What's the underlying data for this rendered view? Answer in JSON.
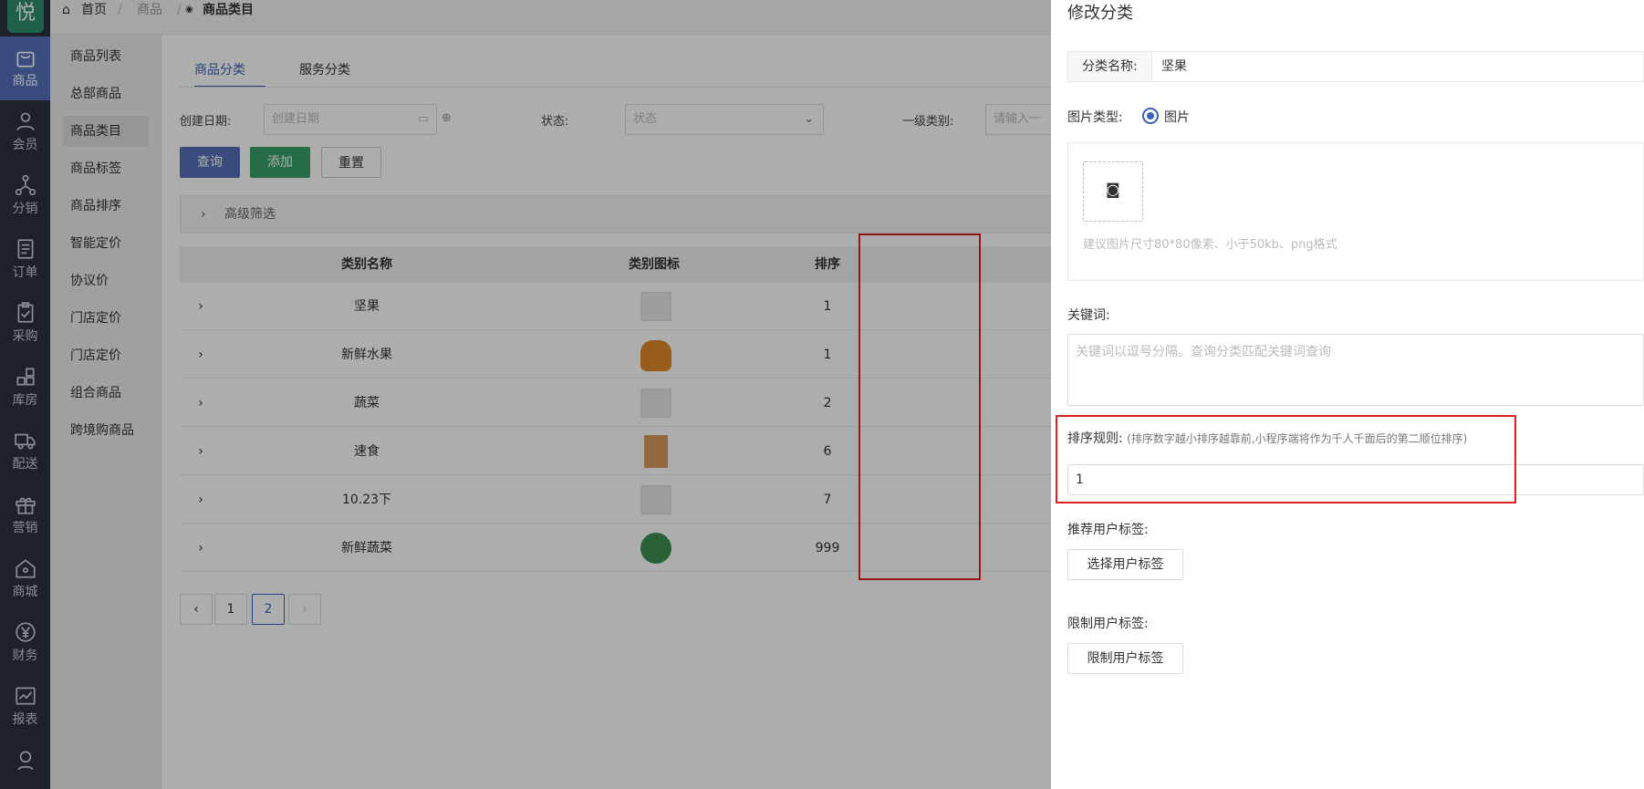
{
  "rail": {
    "logo": "悦",
    "items": [
      {
        "label": "商品",
        "icon": "bag-icon"
      },
      {
        "label": "会员",
        "icon": "user-icon"
      },
      {
        "label": "分销",
        "icon": "network-icon"
      },
      {
        "label": "订单",
        "icon": "order-icon"
      },
      {
        "label": "采购",
        "icon": "clipboard-icon"
      },
      {
        "label": "库房",
        "icon": "warehouse-icon"
      },
      {
        "label": "配送",
        "icon": "truck-icon"
      },
      {
        "label": "营销",
        "icon": "gift-icon"
      },
      {
        "label": "商城",
        "icon": "home-icon"
      },
      {
        "label": "财务",
        "icon": "yen-icon"
      },
      {
        "label": "报表",
        "icon": "chart-icon"
      }
    ]
  },
  "submenu": {
    "items": [
      "商品列表",
      "总部商品",
      "商品类目",
      "商品标签",
      "商品排序",
      "智能定价",
      "协议价",
      "门店定价",
      "门店定价",
      "组合商品",
      "跨境购商品"
    ],
    "active_index": 2
  },
  "breadcrumb": {
    "home": "首页",
    "level1": "商品",
    "current": "商品类目"
  },
  "tabs": [
    "商品分类",
    "服务分类"
  ],
  "filters": {
    "created_label": "创建日期:",
    "created_placeholder": "创建日期",
    "status_label": "状态:",
    "status_placeholder": "状态",
    "level1_label": "一级类别:",
    "level1_placeholder": "请输入一"
  },
  "buttons": {
    "query": "查询",
    "add": "添加",
    "reset": "重置"
  },
  "advanced_filter": "高级筛选",
  "table": {
    "headers": [
      "类别名称",
      "类别图标",
      "排序"
    ],
    "rows": [
      {
        "name": "坚果",
        "icon": "placeholder-image-icon",
        "sort": "1"
      },
      {
        "name": "新鲜水果",
        "icon": "fruit-basket-icon",
        "sort": "1"
      },
      {
        "name": "蔬菜",
        "icon": "placeholder-image-icon",
        "sort": "2"
      },
      {
        "name": "速食",
        "icon": "food-bag-icon",
        "sort": "6"
      },
      {
        "name": "10.23下",
        "icon": "placeholder-image-icon",
        "sort": "7"
      },
      {
        "name": "新鲜蔬菜",
        "icon": "vegetable-icon",
        "sort": "999"
      }
    ]
  },
  "pagination": {
    "prev": "‹",
    "pages": [
      "1",
      "2"
    ],
    "active": "2",
    "next": "›"
  },
  "drawer": {
    "title": "修改分类",
    "name_label": "分类名称:",
    "name_value": "坚果",
    "image_type_label": "图片类型:",
    "image_type_option": "图片",
    "upload_hint": "建议图片尺寸80*80像素、小于50kb、png格式",
    "keywords_label": "关键词:",
    "keywords_placeholder": "关键词以逗号分隔。查询分类匹配关键词查询",
    "sort_rule_label": "排序规则:",
    "sort_rule_note": "(排序数字越小排序越靠前,小程序端将作为千人千面后的第二顺位排序)",
    "sort_value": "1",
    "recommend_tag_label": "推荐用户标签:",
    "recommend_tag_button": "选择用户标签",
    "limit_tag_label": "限制用户标签:",
    "limit_tag_button": "限制用户标签"
  },
  "colors": {
    "accent": "#3a63b8",
    "rail": "#2c323d",
    "add_button": "#3aa36b",
    "highlight": "#e02020"
  }
}
